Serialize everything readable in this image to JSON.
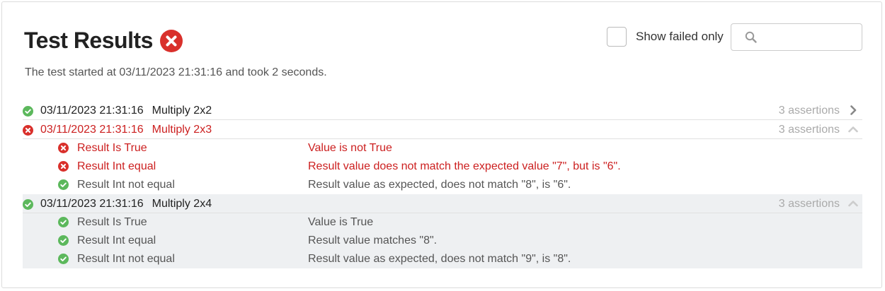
{
  "header": {
    "title": "Test Results",
    "status_icon": "error-circle-icon",
    "subtitle": "The test started at 03/11/2023 21:31:16 and took 2 seconds."
  },
  "filter": {
    "show_failed_label": "Show failed only",
    "show_failed_checked": false,
    "search_value": "",
    "search_placeholder": ""
  },
  "tests": [
    {
      "time": "03/11/2023 21:31:16",
      "name": "Multiply 2x2",
      "status": "pass",
      "assertions_label": "3 assertions",
      "expanded": false,
      "assertions": []
    },
    {
      "time": "03/11/2023 21:31:16",
      "name": "Multiply 2x3",
      "status": "fail",
      "assertions_label": "3 assertions",
      "expanded": true,
      "assertions": [
        {
          "label": "Result Is True",
          "message": "Value is not True",
          "status": "fail"
        },
        {
          "label": "Result Int equal",
          "message": "Result value does not match the expected value \"7\", but is \"6\".",
          "status": "fail"
        },
        {
          "label": "Result Int not equal",
          "message": "Result value as expected, does not match \"8\", is \"6\".",
          "status": "pass"
        }
      ]
    },
    {
      "time": "03/11/2023 21:31:16",
      "name": "Multiply 2x4",
      "status": "pass",
      "assertions_label": "3 assertions",
      "expanded": true,
      "assertions": [
        {
          "label": "Result Is True",
          "message": "Value is True",
          "status": "pass"
        },
        {
          "label": "Result Int equal",
          "message": "Result value matches \"8\".",
          "status": "pass"
        },
        {
          "label": "Result Int not equal",
          "message": "Result value as expected, does not match \"9\", is \"8\".",
          "status": "pass"
        }
      ]
    }
  ],
  "colors": {
    "pass": "#5cb85c",
    "fail": "#d9302b",
    "muted": "#aaaaaa"
  }
}
